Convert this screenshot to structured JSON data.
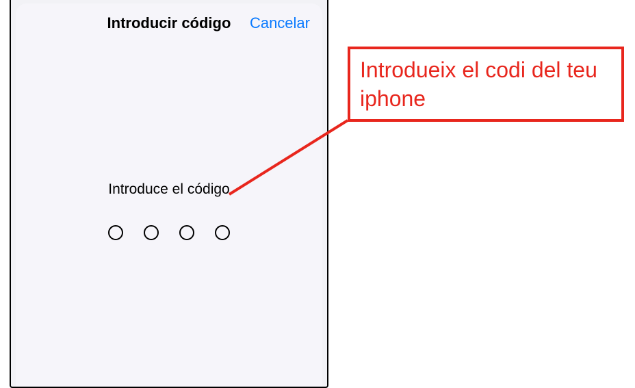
{
  "modal": {
    "title": "Introducir código",
    "cancel_label": "Cancelar",
    "prompt": "Introduce el código",
    "pin_length": 4
  },
  "annotation": {
    "text": "Introdueix el codi del teu iphone",
    "color": "#e8261d"
  }
}
